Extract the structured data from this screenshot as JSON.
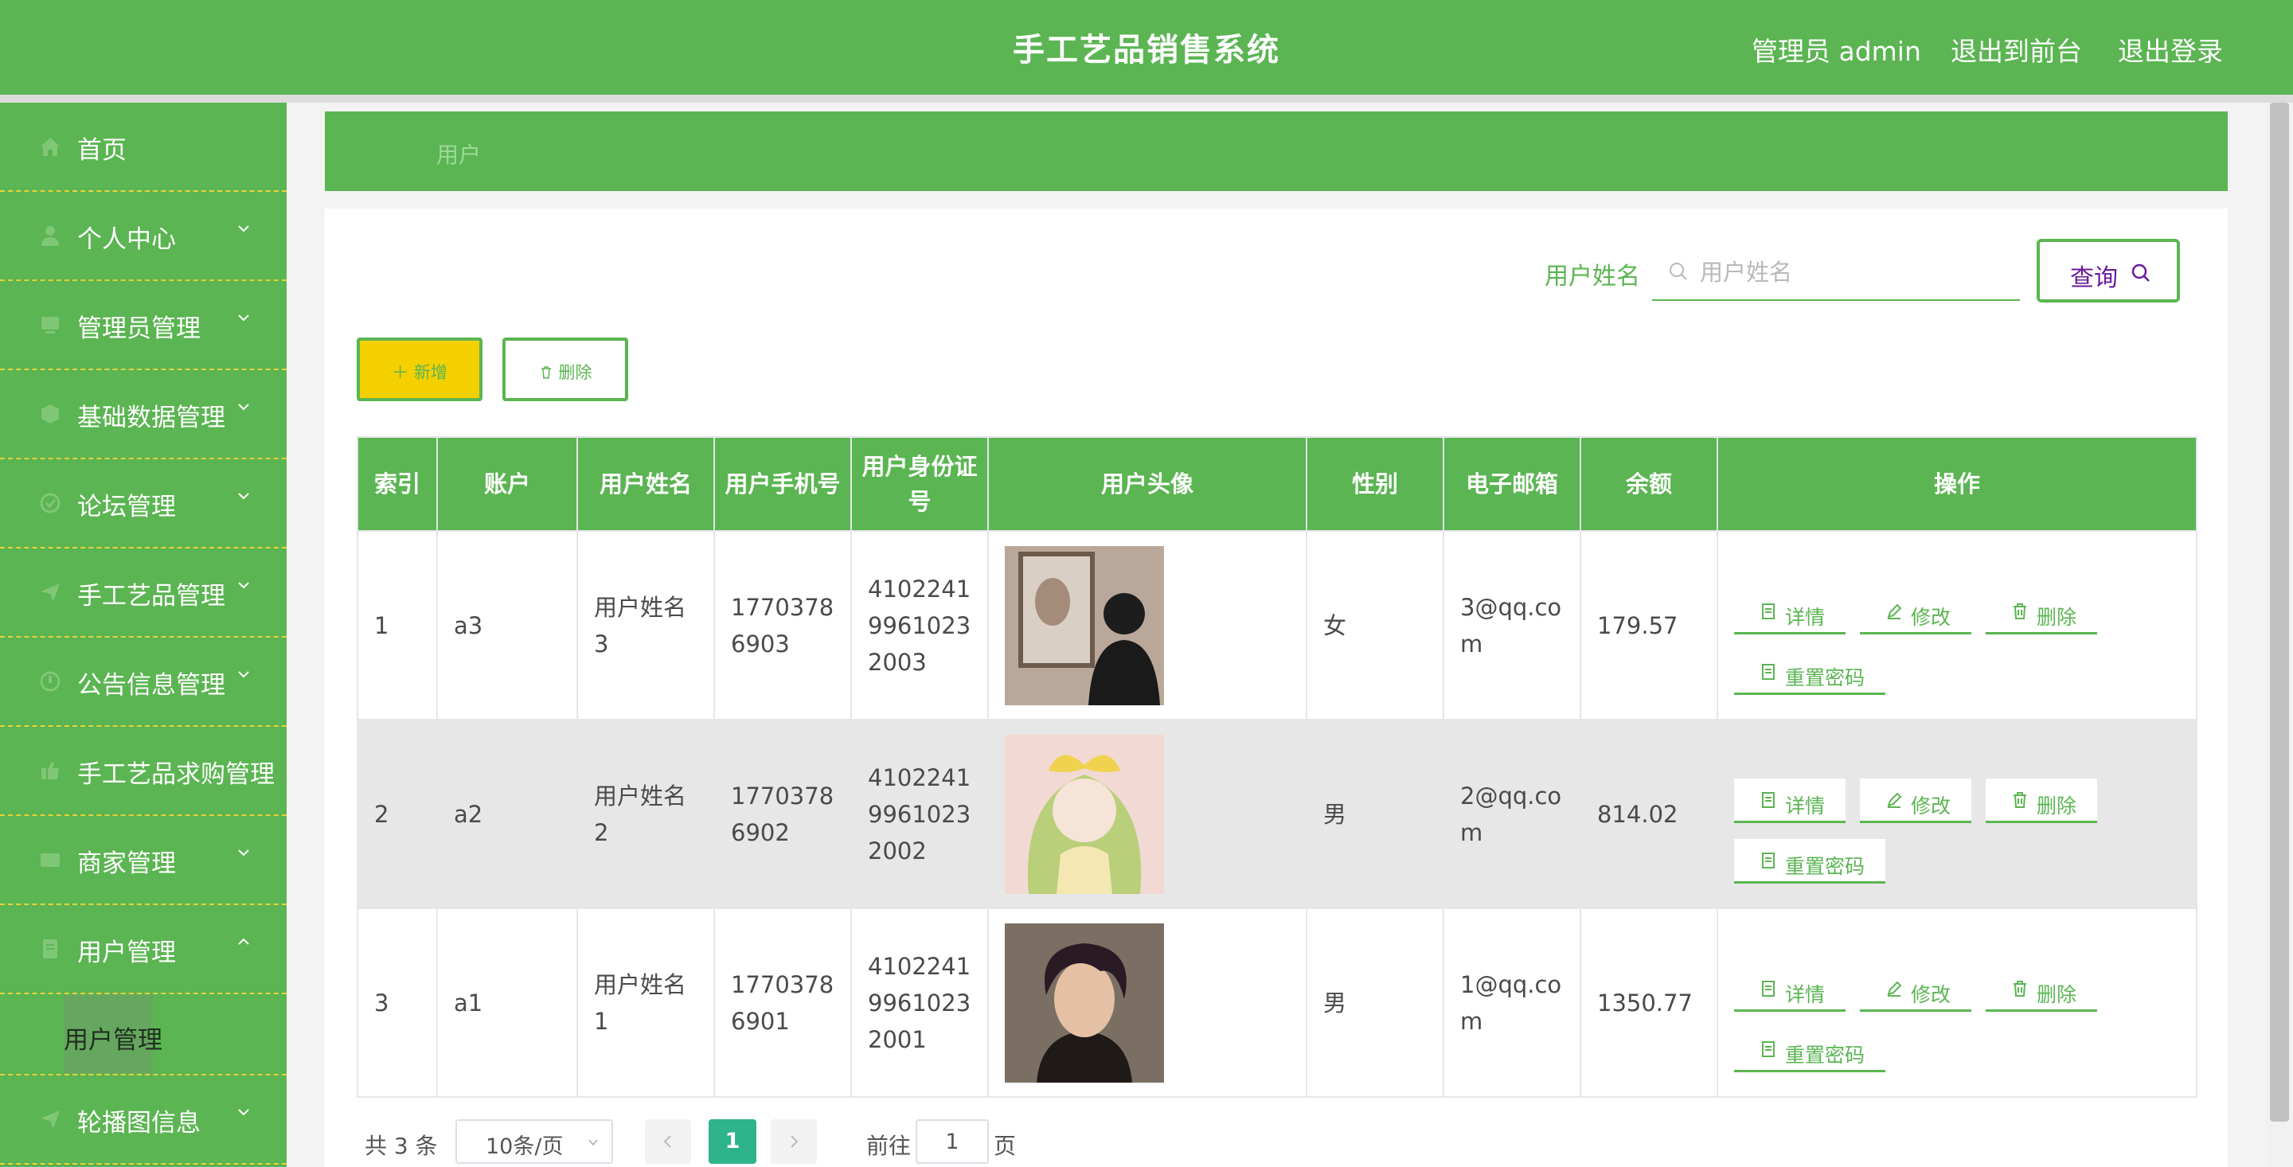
{
  "header": {
    "title": "手工艺品销售系统",
    "user_label": "管理员 admin",
    "front_link": "退出到前台",
    "logout_link": "退出登录"
  },
  "sidebar": {
    "items": [
      {
        "label": "首页",
        "icon": "home-icon"
      },
      {
        "label": "个人中心",
        "icon": "user-icon"
      },
      {
        "label": "管理员管理",
        "icon": "admin-icon"
      },
      {
        "label": "基础数据管理",
        "icon": "data-icon"
      },
      {
        "label": "论坛管理",
        "icon": "forum-icon"
      },
      {
        "label": "手工艺品管理",
        "icon": "craft-icon"
      },
      {
        "label": "公告信息管理",
        "icon": "notice-icon"
      },
      {
        "label": "手工艺品求购管理",
        "icon": "purchase-icon"
      },
      {
        "label": "商家管理",
        "icon": "merchant-icon"
      },
      {
        "label": "用户管理",
        "icon": "users-icon"
      },
      {
        "label": "轮播图信息",
        "icon": "carousel-icon"
      }
    ],
    "submenu_label": "用户管理"
  },
  "breadcrumb": "用户",
  "search": {
    "label": "用户姓名",
    "placeholder": "用户姓名",
    "button": "查询"
  },
  "actions": {
    "add": "新增",
    "delete": "删除"
  },
  "table": {
    "headers": [
      "索引",
      "账户",
      "用户姓名",
      "用户手机号",
      "用户身份证号",
      "用户头像",
      "性别",
      "电子邮箱",
      "余额",
      "操作"
    ],
    "rows": [
      {
        "index": "1",
        "account": "a3",
        "name": "用户姓名3",
        "phone": "17703786903",
        "id_card": "410224199610232003",
        "gender": "女",
        "email": "3@qq.com",
        "balance": "179.57",
        "avatar": "avatar-photo-back-view"
      },
      {
        "index": "2",
        "account": "a2",
        "name": "用户姓名2",
        "phone": "17703786902",
        "id_card": "410224199610232002",
        "gender": "男",
        "email": "2@qq.com",
        "balance": "814.02",
        "avatar": "avatar-anime-girl"
      },
      {
        "index": "3",
        "account": "a1",
        "name": "用户姓名1",
        "phone": "17703786901",
        "id_card": "410224199610232001",
        "gender": "男",
        "email": "1@qq.com",
        "balance": "1350.77",
        "avatar": "avatar-young-man"
      }
    ],
    "row_actions": {
      "detail": "详情",
      "edit": "修改",
      "delete": "删除",
      "reset_password": "重置密码"
    }
  },
  "pagination": {
    "total": "共 3 条",
    "page_size": "10条/页",
    "current_page": "1",
    "goto_label": "前往",
    "goto_value": "1",
    "page_label": "页"
  },
  "colors": {
    "primary": "#5bb552",
    "add_button": "#f4d000",
    "active_page": "#2eb38a",
    "query_text": "#6a1b9a"
  }
}
